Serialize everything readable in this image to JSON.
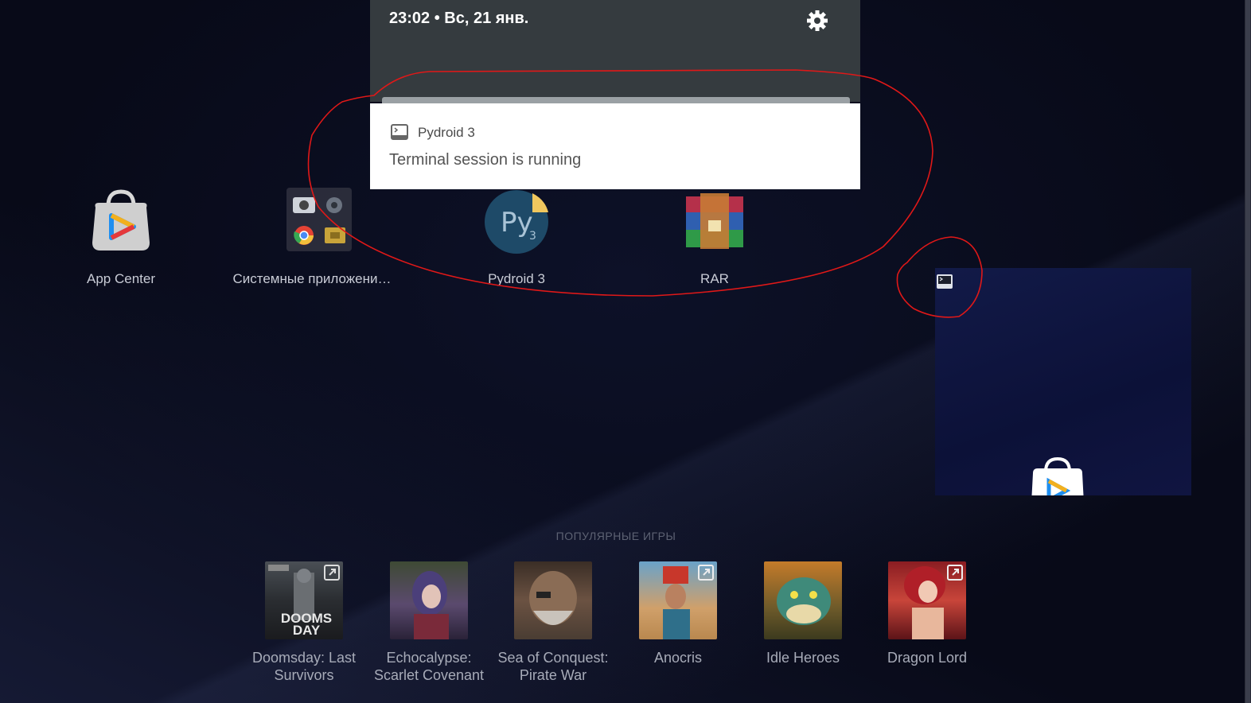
{
  "status_bar": {
    "time_date": "23:02 • Вс, 21 янв."
  },
  "notification": {
    "app_name": "Pydroid 3",
    "message": "Terminal session is running"
  },
  "desktop_apps": [
    {
      "label": "App Center",
      "icon": "app-center-bag-icon"
    },
    {
      "label": "Системные приложени…",
      "icon": "system-apps-folder-icon"
    },
    {
      "label": "Pydroid 3",
      "icon": "pydroid-icon"
    },
    {
      "label": "RAR",
      "icon": "rar-icon"
    }
  ],
  "popular": {
    "title": "ПОПУЛЯРНЫЕ ИГРЫ",
    "games": [
      {
        "name": "Doomsday: Last Survivors",
        "thumb_text": "DOOMS DAY"
      },
      {
        "name": "Echocalypse: Scarlet Covenant"
      },
      {
        "name": "Sea of Conquest: Pirate War"
      },
      {
        "name": "Anocris"
      },
      {
        "name": "Idle Heroes"
      },
      {
        "name": "Dragon Lord"
      }
    ]
  },
  "colors": {
    "annotation": "#e01818",
    "shade": "#353b3f",
    "background": "#0a0d1f"
  }
}
